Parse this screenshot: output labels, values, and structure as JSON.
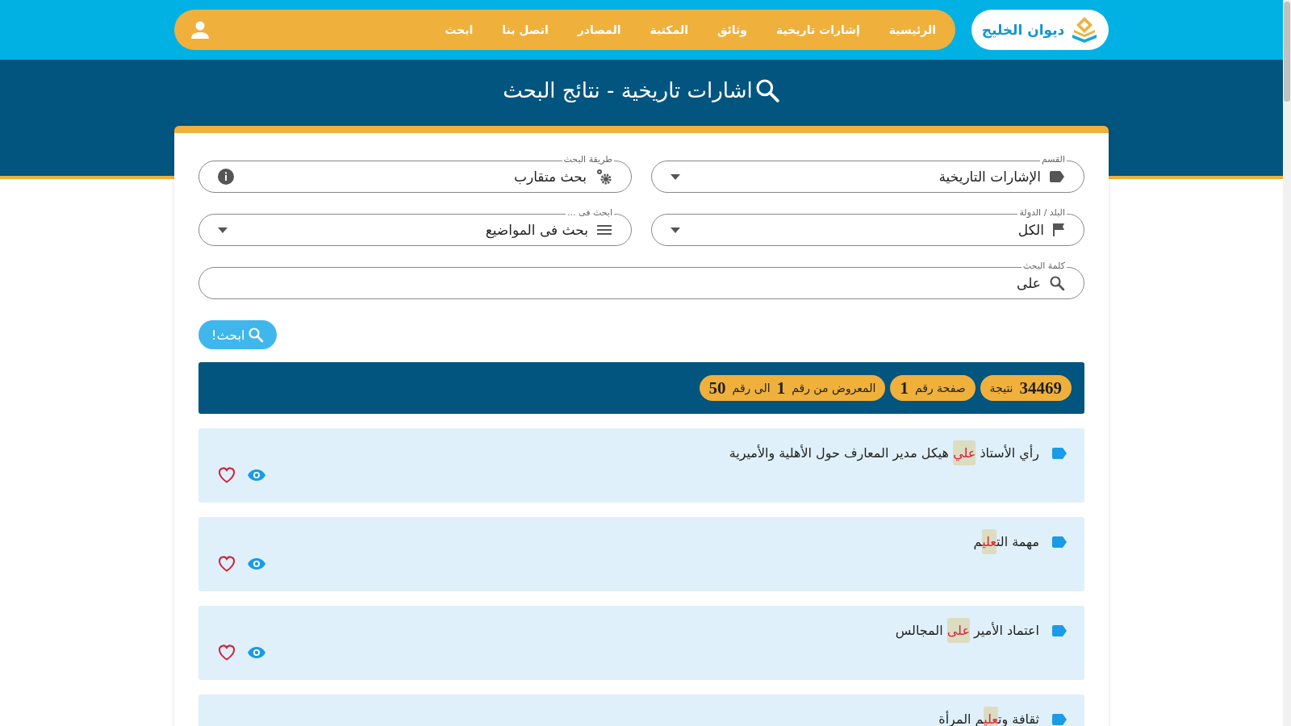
{
  "header": {
    "logo_text": "ديوان الخليج",
    "nav": [
      "الرئيسية",
      "إشارات تاريخية",
      "وثائق",
      "المكتبة",
      "المصادر",
      "اتصل بنا",
      "ابحث"
    ]
  },
  "page_title": "اشارات تاريخية - نتائج البحث",
  "filters": [
    {
      "label": "القسم",
      "value": "الإشارات التاريخية",
      "kind": "dropdown"
    },
    {
      "label": "طريقة البحث",
      "value": "بحث متقارب",
      "kind": "info"
    },
    {
      "label": "البلد / الدولة",
      "value": "الكل",
      "kind": "dropdown"
    },
    {
      "label": "ابحث فى ...",
      "value": "بحث فى المواضيع",
      "kind": "dropdown"
    }
  ],
  "search": {
    "label": "كلمة البحث",
    "value": "على"
  },
  "search_button": "ابحث!",
  "summary": [
    [
      {
        "kind": "number",
        "text": "34469"
      },
      {
        "kind": "text",
        "text": "نتيجة"
      }
    ],
    [
      {
        "kind": "text",
        "text": "صفحة رقم"
      },
      {
        "kind": "number",
        "text": "1"
      }
    ],
    [
      {
        "kind": "text",
        "text": "المعروض من رقم"
      },
      {
        "kind": "number",
        "text": "1"
      },
      {
        "kind": "text",
        "text": "الى رقم"
      },
      {
        "kind": "number",
        "text": "50"
      }
    ]
  ],
  "results": [
    {
      "before": "رأي الأستاذ ",
      "match": "علي",
      "after": " هيكل مدير المعارف حول الأهلية والأميرية",
      "actions": true
    },
    {
      "before": "مهمة الت",
      "match": "علي",
      "after": "م",
      "actions": true
    },
    {
      "before": "اعتماد الأمير ",
      "match": "على",
      "after": " المجالس",
      "actions": true
    },
    {
      "before": "ثقافة وت",
      "match": "علي",
      "after": "م المرأة"
    }
  ]
}
